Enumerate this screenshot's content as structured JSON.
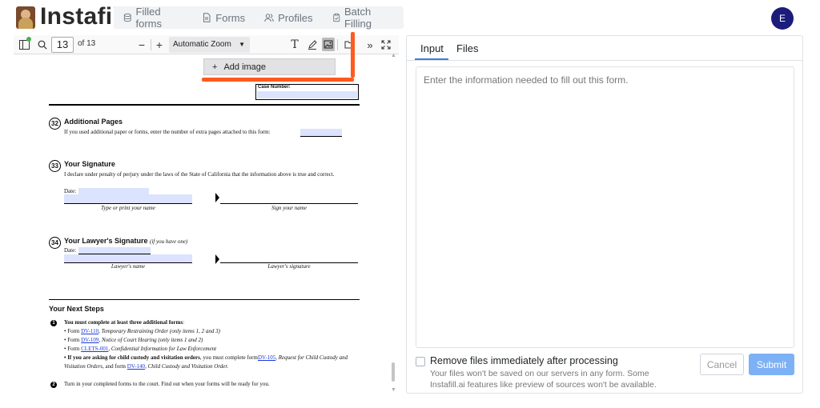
{
  "header": {
    "brand": "Instafill",
    "nav": [
      {
        "label": "Filled forms",
        "icon": "database-icon"
      },
      {
        "label": "Forms",
        "icon": "document-icon"
      },
      {
        "label": "Profiles",
        "icon": "users-icon"
      },
      {
        "label": "Batch Filling",
        "icon": "clipboard-icon"
      }
    ],
    "avatar_initial": "E",
    "avatar_color": "#1c1c7a"
  },
  "viewer": {
    "page_number": "13",
    "page_total": "of 13",
    "zoom": "Automatic Zoom",
    "popup_label": "Add image",
    "annotation_color": "#ff5a1f"
  },
  "pdf": {
    "case_number_label": "Case Number:",
    "s32": {
      "num": "32",
      "title": "Additional Pages",
      "text": "If you used additional paper or forms, enter the number of extra pages attached to this form:"
    },
    "s33": {
      "num": "33",
      "title": "Your Signature",
      "text": "I declare under penalty of perjury under the laws of the State of California that the information above is true and correct.",
      "date_label": "Date:",
      "cap_left": "Type or print your name",
      "cap_right": "Sign your name"
    },
    "s34": {
      "num": "34",
      "title": "Your Lawyer's Signature",
      "title_note": "(if you have one)",
      "date_label": "Date:",
      "cap_left": "Lawyer's name",
      "cap_right": "Lawyer's signature"
    },
    "next": {
      "title": "Your Next Steps",
      "step1_num": "1",
      "step1_title": "You must complete at least three additional forms",
      "step1_colon": ":",
      "items": [
        {
          "pre": "• Form ",
          "link": "DV-110",
          "post": ", Temporary Restraining Order (only items 1, 2 and 3)"
        },
        {
          "pre": "• Form ",
          "link": "DV-109",
          "post": ", Notice of Court Hearing (only items 1 and 2)"
        },
        {
          "pre": "• Form ",
          "link": "CLETS-001",
          "post": ", Confidential Information for Law Enforcement"
        }
      ],
      "custody_bold": "• If you are asking for child custody and visitation orders",
      "custody_mid": ", you must complete form",
      "custody_link1": "DV-105",
      "custody_mid2": ", Request for Child Custody and Visitation Orders",
      "custody_and": ", and form ",
      "custody_link2": "DV-140",
      "custody_end": ", Child Custody and Visitation Order.",
      "step2_num": "2",
      "step2_text": "Turn in your completed forms to the court. Find out when your forms will be ready for you."
    }
  },
  "panel": {
    "tabs": [
      "Input",
      "Files"
    ],
    "active_tab": "Input",
    "placeholder": "Enter the information needed to fill out this form.",
    "checkbox_label": "Remove files immediately after processing",
    "checkbox_hint": "Your files won't be saved on our servers in any form. Some Instafill.ai features like preview of sources won't be available.",
    "cancel_label": "Cancel",
    "submit_label": "Submit",
    "accent_color": "#3b7fd8"
  }
}
